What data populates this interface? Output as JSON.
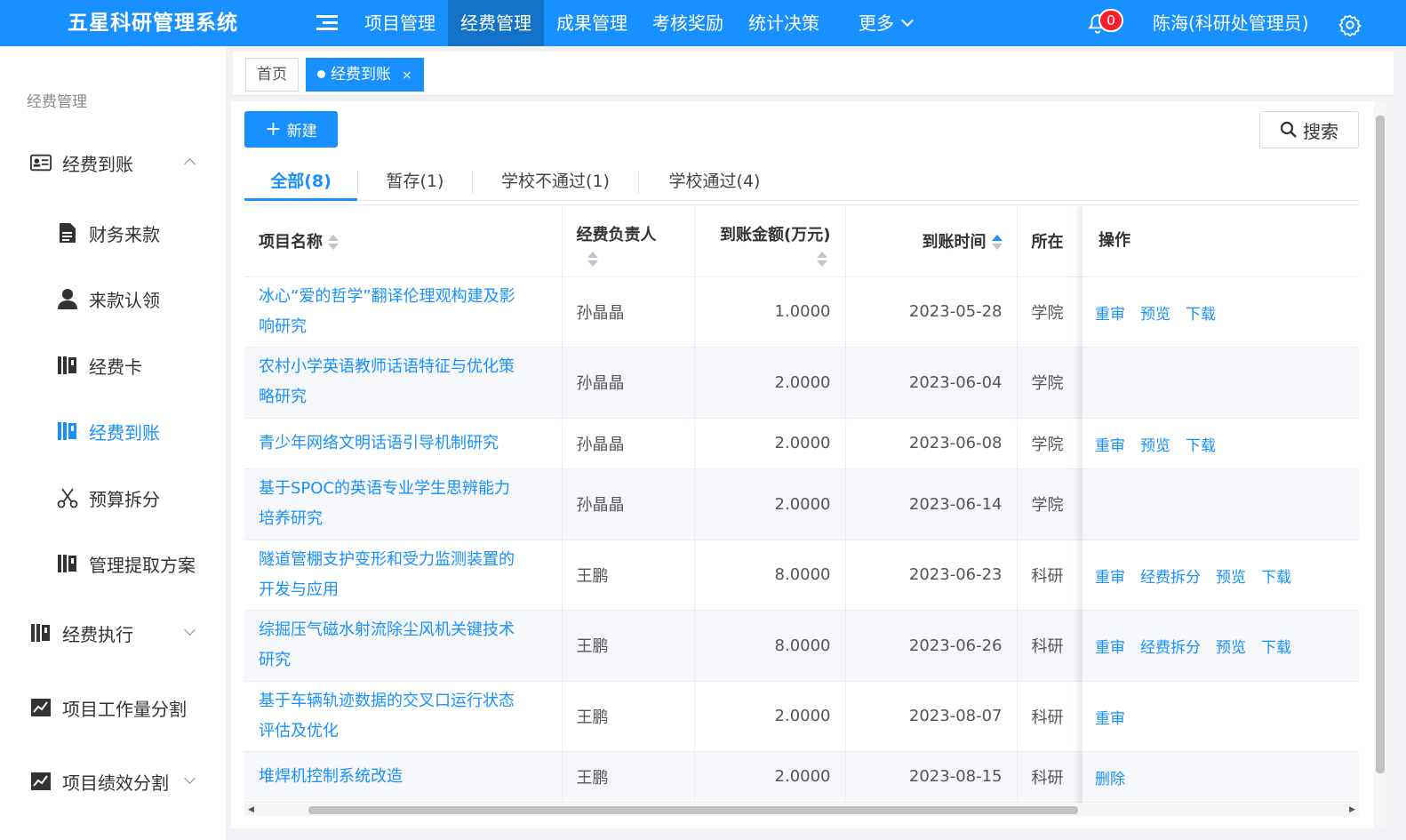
{
  "app": {
    "title": "五星科研管理系统"
  },
  "nav": {
    "items": [
      "项目管理",
      "经费管理",
      "成果管理",
      "考核奖励",
      "统计决策"
    ],
    "more": "更多"
  },
  "header": {
    "notifications": "0",
    "user": "陈海(科研处管理员)"
  },
  "sidebar": {
    "title": "经费管理",
    "items": [
      {
        "label": "经费到账",
        "icon": "id-card-icon"
      },
      {
        "label": "财务来款",
        "icon": "document-icon"
      },
      {
        "label": "来款认领",
        "icon": "user-icon"
      },
      {
        "label": "经费卡",
        "icon": "book-icon"
      },
      {
        "label": "经费到账",
        "icon": "book-icon"
      },
      {
        "label": "预算拆分",
        "icon": "scissors-icon"
      },
      {
        "label": "管理提取方案",
        "icon": "book-icon"
      },
      {
        "label": "经费执行",
        "icon": "book-icon"
      },
      {
        "label": "项目工作量分割",
        "icon": "chart-icon"
      },
      {
        "label": "项目绩效分割",
        "icon": "chart-icon"
      }
    ]
  },
  "tags": {
    "home": "首页",
    "current": "经费到账",
    "close": "×"
  },
  "toolbar": {
    "new": "新建",
    "search": "搜索"
  },
  "tabs": [
    "全部(8)",
    "暂存(1)",
    "学校不通过(1)",
    "学校通过(4)"
  ],
  "table": {
    "headers": [
      "项目名称",
      "经费负责人",
      "到账金额(万元)",
      "到账时间",
      "所在",
      "操作"
    ],
    "rows": [
      {
        "name1": "冰心“爱的哲学”翻译伦理观构建及影",
        "name2": "响研究",
        "owner": "孙晶晶",
        "amount": "1.0000",
        "date": "2023-05-28",
        "unit": "学院",
        "ops": [
          "重审",
          "预览",
          "下载"
        ]
      },
      {
        "name1": "农村小学英语教师话语特征与优化策",
        "name2": "略研究",
        "owner": "孙晶晶",
        "amount": "2.0000",
        "date": "2023-06-04",
        "unit": "学院",
        "ops": []
      },
      {
        "name1": "青少年网络文明话语引导机制研究",
        "name2": "",
        "owner": "孙晶晶",
        "amount": "2.0000",
        "date": "2023-06-08",
        "unit": "学院",
        "ops": [
          "重审",
          "预览",
          "下载"
        ]
      },
      {
        "name1": "基于SPOC的英语专业学生思辨能力",
        "name2": "培养研究",
        "owner": "孙晶晶",
        "amount": "2.0000",
        "date": "2023-06-14",
        "unit": "学院",
        "ops": []
      },
      {
        "name1": "隧道管棚支护变形和受力监测装置的",
        "name2": "开发与应用",
        "owner": "王鹏",
        "amount": "8.0000",
        "date": "2023-06-23",
        "unit": "科研",
        "ops": [
          "重审",
          "经费拆分",
          "预览",
          "下载"
        ]
      },
      {
        "name1": "综掘压气磁水射流除尘风机关键技术",
        "name2": "研究",
        "owner": "王鹏",
        "amount": "8.0000",
        "date": "2023-06-26",
        "unit": "科研",
        "ops": [
          "重审",
          "经费拆分",
          "预览",
          "下载"
        ]
      },
      {
        "name1": "基于车辆轨迹数据的交叉口运行状态",
        "name2": "评估及优化",
        "owner": "王鹏",
        "amount": "2.0000",
        "date": "2023-08-07",
        "unit": "科研",
        "ops": [
          "重审"
        ]
      },
      {
        "name1": "堆焊机控制系统改造",
        "name2": "",
        "owner": "王鹏",
        "amount": "2.0000",
        "date": "2023-08-15",
        "unit": "科研",
        "ops": [
          "删除"
        ]
      }
    ]
  },
  "colors": {
    "primary": "#1890ff",
    "stripe": "#f5f7fa"
  }
}
